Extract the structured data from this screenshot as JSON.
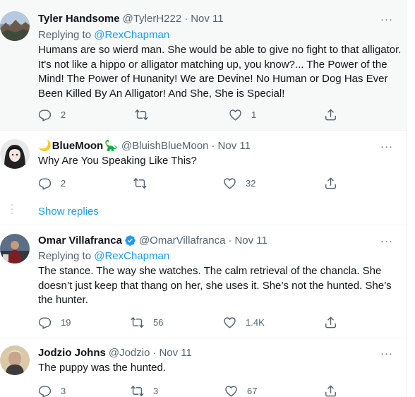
{
  "colors": {
    "accent": "#1d9bf0",
    "verified": "#1d9bf0",
    "secondary": "#536471",
    "highlight_bg": "#f7f9f9"
  },
  "tweets": [
    {
      "name": "Tyler Handsome",
      "handle": "@TylerH222",
      "dot": "·",
      "date": "Nov 11",
      "replying_prefix": "Replying to",
      "replying_to": "@RexChapman",
      "text": "Humans are so wierd man. She would be able to give no fight to that alligator. It's not like a hippo or alligator matching up, you know?... The Power of the Mind! The Power of Hunanity! We are Devine! No Human or Dog Has Ever Been Killed By An Alligator! And She, She is Special!",
      "replies": "2",
      "retweets": "",
      "likes": "1"
    },
    {
      "name_prefix_emoji": "🌙",
      "name": "BlueMoon",
      "name_suffix_emoji": "🦕",
      "handle": "@BluishBlueMoon",
      "dot": "·",
      "date": "Nov 11",
      "text": "Why Are You Speaking Like This?",
      "replies": "2",
      "retweets": "",
      "likes": "32"
    },
    {
      "name": "Omar Villafranca",
      "verified": true,
      "handle": "@OmarVillafranca",
      "dot": "·",
      "date": "Nov 11",
      "replying_prefix": "Replying to",
      "replying_to": "@RexChapman",
      "text": "The stance. The way she watches. The calm retrieval of the chancla. She doesn’t just keep that thang on her, she uses it. She’s not the hunted. She’s the hunter.",
      "replies": "19",
      "retweets": "56",
      "likes": "1.4K"
    },
    {
      "name": "Jodzio Johns",
      "handle": "@Jodzio",
      "dot": "·",
      "date": "Nov 11",
      "text": "The puppy was the hunted.",
      "replies": "3",
      "retweets": "3",
      "likes": "67"
    }
  ],
  "show_replies": "Show replies",
  "more_glyph": "···",
  "icons": [
    "reply-icon",
    "retweet-icon",
    "like-icon",
    "share-icon",
    "more-icon",
    "verified-badge-icon"
  ]
}
